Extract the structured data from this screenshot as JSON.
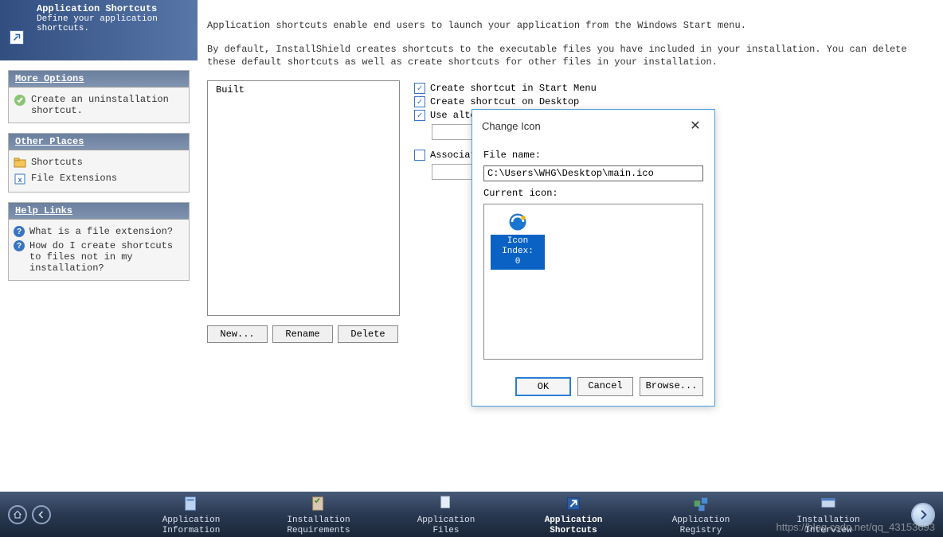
{
  "sidebar": {
    "header": {
      "title": "Application Shortcuts",
      "subtitle": "Define your application shortcuts."
    },
    "panels": {
      "more_options": {
        "title": "More Options",
        "items": [
          {
            "label": "Create an uninstallation shortcut."
          }
        ]
      },
      "other_places": {
        "title": "Other Places",
        "items": [
          {
            "label": "Shortcuts"
          },
          {
            "label": "File Extensions"
          }
        ]
      },
      "help_links": {
        "title": "Help Links",
        "items": [
          {
            "label": "What is a file extension?"
          },
          {
            "label": "How do I create shortcuts to files not in my installation?"
          }
        ]
      }
    }
  },
  "main": {
    "intro1": "Application shortcuts enable end users to launch your application from the Windows Start menu.",
    "intro2": "By default, InstallShield creates shortcuts to the executable files you have included in your installation. You can delete these default shortcuts as well as create shortcuts for other files in your installation.",
    "listbox_item": "Built",
    "buttons": {
      "new": "New...",
      "rename": "Rename",
      "delete": "Delete"
    },
    "checks": {
      "start_menu": "Create shortcut in Start Menu",
      "desktop": "Create shortcut on Desktop",
      "alt_icon": "Use alternate",
      "associate": "Associate a"
    }
  },
  "dialog": {
    "title": "Change Icon",
    "file_name_label": "File name:",
    "file_name_value": "C:\\Users\\WHG\\Desktop\\main.ico",
    "current_icon_label": "Current icon:",
    "icon_index_label": "Icon Index:",
    "icon_index_value": "0",
    "buttons": {
      "ok": "OK",
      "cancel": "Cancel",
      "browse": "Browse..."
    }
  },
  "bottombar": {
    "items": [
      {
        "label1": "Application",
        "label2": "Information"
      },
      {
        "label1": "Installation",
        "label2": "Requirements"
      },
      {
        "label1": "Application",
        "label2": "Files"
      },
      {
        "label1": "Application",
        "label2": "Shortcuts"
      },
      {
        "label1": "Application",
        "label2": "Registry"
      },
      {
        "label1": "Installation",
        "label2": "Interview"
      }
    ]
  },
  "watermark": "https://blog.csdn.net/qq_43153693"
}
